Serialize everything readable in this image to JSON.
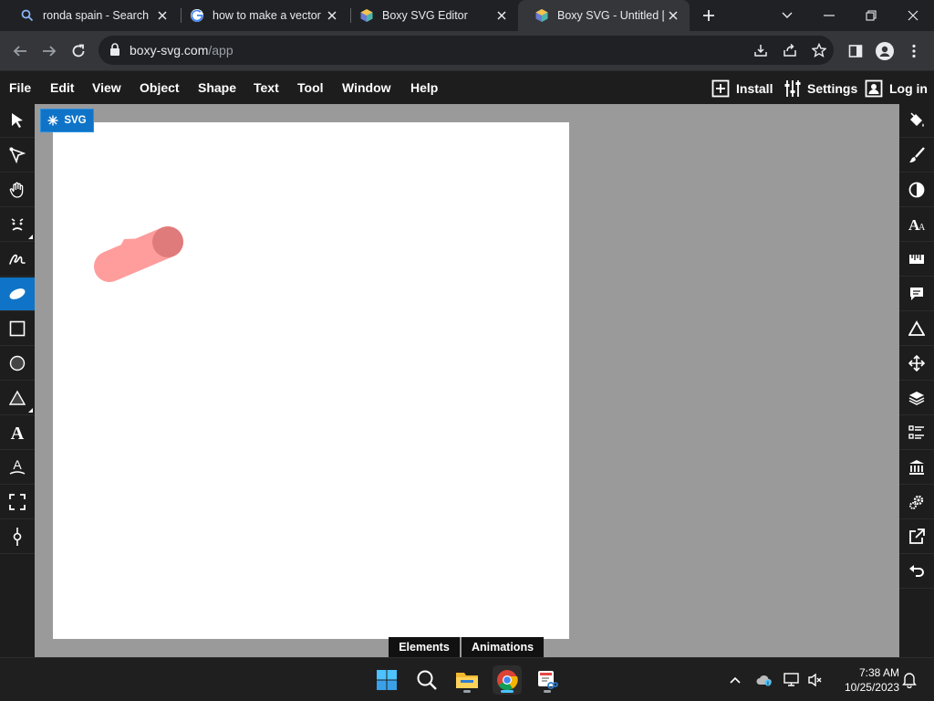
{
  "browser": {
    "tabs": [
      {
        "title": "ronda spain - Search",
        "favicon": "search-icon"
      },
      {
        "title": "how to make a vector i",
        "favicon": "google-icon"
      },
      {
        "title": "Boxy SVG Editor",
        "favicon": "boxy-svg-icon"
      },
      {
        "title": "Boxy SVG - Untitled [Ed",
        "favicon": "boxy-svg-icon",
        "active": true
      }
    ],
    "url_host": "boxy-svg.com",
    "url_path": "/app"
  },
  "app": {
    "menu": [
      "File",
      "Edit",
      "View",
      "Object",
      "Shape",
      "Text",
      "Tool",
      "Window",
      "Help"
    ],
    "install_label": "Install",
    "settings_label": "Settings",
    "login_label": "Log in",
    "artboard_badge": "SVG",
    "left_tools": [
      "selection-arrow-icon",
      "edit-arrow-icon",
      "hand-icon",
      "face-icon",
      "freehand-icon",
      "ellipse-brush-icon",
      "rectangle-icon",
      "circle-icon",
      "triangle-icon",
      "text-icon",
      "text-path-icon",
      "crop-icon",
      "gradient-icon"
    ],
    "active_tool": "ellipse-brush-icon",
    "right_panels": [
      "paint-bucket-icon",
      "brush-icon",
      "contrast-icon",
      "typography-icon",
      "ruler-icon",
      "comment-icon",
      "triangle-icon",
      "move-icon",
      "layers-icon",
      "list-icon",
      "library-icon",
      "gears-icon",
      "export-icon",
      "undo-icon"
    ],
    "bottom_tabs": [
      "Elements",
      "Animations"
    ],
    "stroke_color_light": "#ff9c9c",
    "stroke_color_dark": "#e07b7b",
    "accent": "#0f74c7"
  },
  "taskbar": {
    "time": "7:38 AM",
    "date": "10/25/2023"
  }
}
